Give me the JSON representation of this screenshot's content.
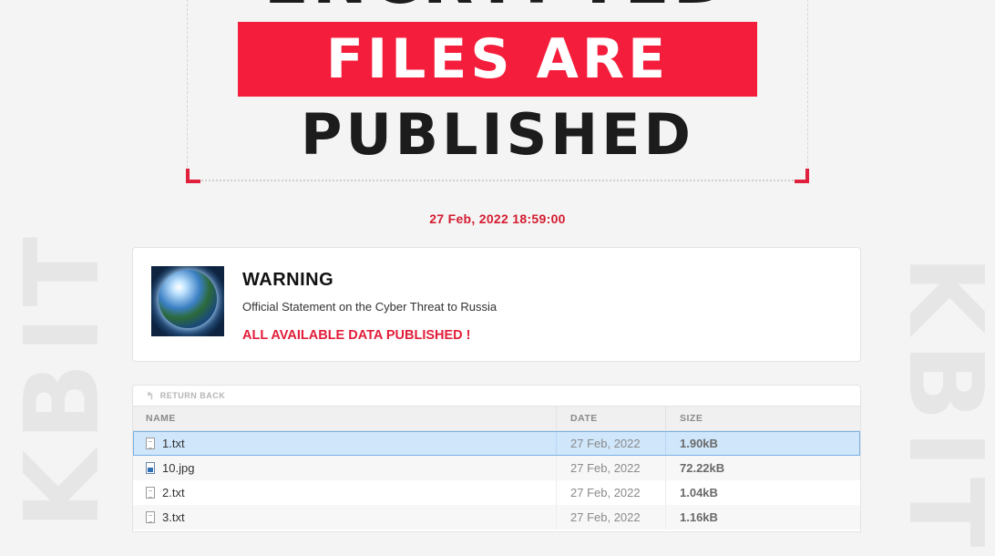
{
  "watermark": {
    "text": "KBIT"
  },
  "hero": {
    "line_top": "ENCRYPTED",
    "line_mid": "FILES ARE",
    "line_bottom": "PUBLISHED"
  },
  "date": "27 Feb, 2022 18:59:00",
  "card": {
    "title": "WARNING",
    "subtitle": "Official Statement on the Cyber Threat to Russia",
    "alert": "ALL AVAILABLE DATA PUBLISHED !",
    "image": "globe-image"
  },
  "files": {
    "return_label": "RETURN BACK",
    "return_icon": "return-arrow-icon",
    "columns": {
      "name": "NAME",
      "date": "DATE",
      "size": "SIZE"
    },
    "rows": [
      {
        "name": "1.txt",
        "date": "27 Feb, 2022",
        "size": "1.90kB",
        "icon": "text-file-icon",
        "selected": true
      },
      {
        "name": "10.jpg",
        "date": "27 Feb, 2022",
        "size": "72.22kB",
        "icon": "image-file-icon",
        "selected": false
      },
      {
        "name": "2.txt",
        "date": "27 Feb, 2022",
        "size": "1.04kB",
        "icon": "text-file-icon",
        "selected": false
      },
      {
        "name": "3.txt",
        "date": "27 Feb, 2022",
        "size": "1.16kB",
        "icon": "text-file-icon",
        "selected": false
      }
    ]
  },
  "colors": {
    "accent_red": "#f41d3b",
    "selection": "#cfe6fb"
  }
}
